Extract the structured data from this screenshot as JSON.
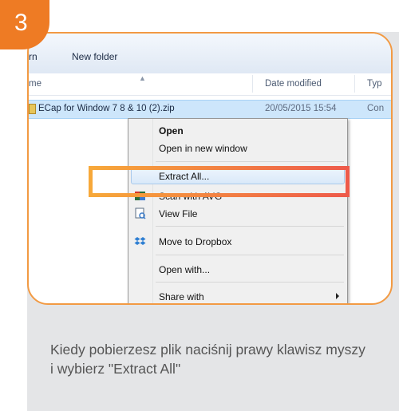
{
  "step": {
    "number": "3"
  },
  "explorer": {
    "toolbar": {
      "partial_item": "rn",
      "new_folder": "New folder"
    },
    "columns": {
      "name_partial": "me",
      "date_modified": "Date modified",
      "type_partial": "Typ"
    },
    "file": {
      "name": "ECap for Window 7 8 & 10 (2).zip",
      "date": "20/05/2015 15:54",
      "type_partial": "Con"
    }
  },
  "context_menu": {
    "items": [
      {
        "label": "Open",
        "icon": ""
      },
      {
        "label": "Open in new window",
        "icon": ""
      },
      {
        "label": "Extract All...",
        "icon": ""
      },
      {
        "label": "Scan with AVG",
        "icon": "avg-icon"
      },
      {
        "label": "View File",
        "icon": "view-file-icon"
      },
      {
        "label": "Move to Dropbox",
        "icon": "dropbox-icon"
      },
      {
        "label": "Open with...",
        "icon": ""
      },
      {
        "label": "Share with",
        "icon": "submenu-arrow-icon"
      }
    ]
  },
  "caption": {
    "text": "Kiedy pobierzesz plik naciśnij  prawy klawisz myszy  i wybierz \"Extract All\""
  },
  "colors": {
    "accent_orange": "#ee7b24",
    "frame_border": "#f29a43",
    "highlight_start": "#f7a83a",
    "highlight_end": "#ee5a4a",
    "card_bg": "#e4e5e7",
    "selection": "#cde6fb"
  }
}
